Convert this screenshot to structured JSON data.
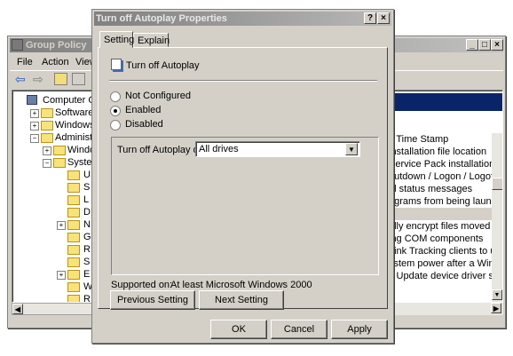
{
  "gp": {
    "title": "Group Policy",
    "menu": [
      "File",
      "Action",
      "View"
    ],
    "tree": [
      "Computer Con",
      "Software",
      "Windows",
      "Administra",
      "Windo",
      "Syste",
      "U",
      "S",
      "L",
      "D",
      "N",
      "G",
      "R",
      "S",
      "E",
      "W",
      "R"
    ],
    "list": [
      "c Time Stamp",
      "installation file location",
      "Service Pack installation fil",
      "hutdown / Logon / Logoff s",
      "al status messages",
      "ograms from being launche",
      "y",
      "ally encrypt files moved to",
      "ing COM components",
      "Link Tracking clients to use",
      "ystem power after a Windo",
      "s Update device driver sea"
    ]
  },
  "dialog": {
    "title": "Turn off Autoplay Properties",
    "tabs": [
      "Setting",
      "Explain"
    ],
    "policy_name": "Turn off Autoplay",
    "radios": {
      "not_configured": "Not Configured",
      "enabled": "Enabled",
      "disabled": "Disabled"
    },
    "selected": "enabled",
    "option_label": "Turn off Autoplay on:",
    "option_value": "All drives",
    "supported_label": "Supported on:",
    "supported_value": "At least Microsoft Windows 2000",
    "prev_button": "Previous Setting",
    "next_button": "Next Setting",
    "ok": "OK",
    "cancel": "Cancel",
    "apply": "Apply",
    "help_glyph": "?",
    "close_glyph": "×"
  }
}
